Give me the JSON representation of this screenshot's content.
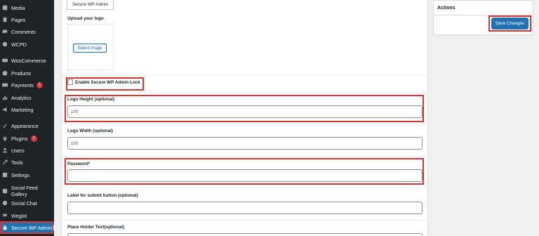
{
  "sidebar": {
    "items": [
      {
        "label": "Media",
        "icon": "media-icon"
      },
      {
        "label": "Pages",
        "icon": "pages-icon"
      },
      {
        "label": "Comments",
        "icon": "comments-icon"
      },
      {
        "label": "WCPD",
        "icon": "wcpd-icon"
      },
      {
        "label": "WooCommerce",
        "icon": "woocommerce-icon"
      },
      {
        "label": "Products",
        "icon": "products-icon"
      },
      {
        "label": "Payments",
        "icon": "payments-icon",
        "badge": "1"
      },
      {
        "label": "Analytics",
        "icon": "analytics-icon"
      },
      {
        "label": "Marketing",
        "icon": "marketing-icon"
      },
      {
        "label": "Appearance",
        "icon": "appearance-icon"
      },
      {
        "label": "Plugins",
        "icon": "plugins-icon",
        "badge": "1"
      },
      {
        "label": "Users",
        "icon": "users-icon"
      },
      {
        "label": "Tools",
        "icon": "tools-icon"
      },
      {
        "label": "Settings",
        "icon": "settings-icon"
      },
      {
        "label": "Social Feed Gallery",
        "icon": "social-feed-icon"
      },
      {
        "label": "Social Chat",
        "icon": "social-chat-icon"
      },
      {
        "label": "Weglot",
        "icon": "weglot-icon"
      },
      {
        "label": "Secure WP Admin",
        "icon": "lock-icon",
        "active": true
      }
    ]
  },
  "main": {
    "tab": "Secure WP Admin",
    "upload_logo_label": "Upload your logo",
    "select_image_label": "Select Image",
    "enable_lock_label": "Enable Secure WP Admin Lock",
    "logo_height_label": "Logo Height (optional)",
    "logo_height_placeholder": "100",
    "logo_width_label": "Logo Width (optional)",
    "logo_width_value": "100",
    "password_label": "Password*",
    "password_value": "",
    "submit_label_label": "Label for submit button (optional)",
    "submit_label_value": "",
    "placeholder_text_label": "Place Holder Text(optional)"
  },
  "actions": {
    "title": "Actions",
    "save_label": "Save Changes"
  },
  "colors": {
    "accent": "#2271b1",
    "highlight": "#d63638",
    "sidebar_bg": "#1d2327"
  }
}
